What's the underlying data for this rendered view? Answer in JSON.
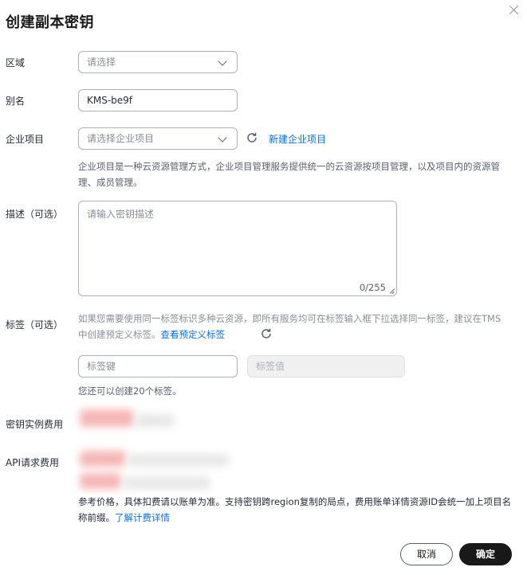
{
  "dialog": {
    "title": "创建副本密钥",
    "close_icon": "close-icon"
  },
  "region": {
    "label": "区域",
    "placeholder": "请选择",
    "icon": "chevron-down-icon"
  },
  "alias": {
    "label": "别名",
    "value": "KMS-be9f"
  },
  "enterprise_project": {
    "label": "企业项目",
    "placeholder": "请选择企业项目",
    "refresh_icon": "refresh-icon",
    "new_link": "新建企业项目",
    "help": "企业项目是一种云资源管理方式，企业项目管理服务提供统一的云资源按项目管理，以及项目内的资源管理、成员管理。"
  },
  "description": {
    "label": "描述（可选）",
    "placeholder": "请输入密钥描述",
    "counter": "0/255"
  },
  "tags": {
    "label": "标签（可选）",
    "help_prefix": "如果您需要使用同一标签标识多种云资源，即所有服务均可在标签输入框下拉选择同一标签，建议在TMS中创建预定义标签。",
    "view_link": "查看预定义标签",
    "refresh_icon": "refresh-icon",
    "key_placeholder": "标签键",
    "value_placeholder": "标签值",
    "remaining": "您还可以创建20个标签。"
  },
  "key_instance_fee": {
    "label": "密钥实例费用"
  },
  "api_fee": {
    "label": "API请求费用"
  },
  "pricing_note": {
    "text": "参考价格，具体扣费请以账单为准。支持密钥跨region复制的局点，费用账单详情资源ID会统一加上项目名称前缀。",
    "link": "了解计费详情"
  },
  "footer": {
    "cancel_label": "取消",
    "ok_label": "确定"
  },
  "colors": {
    "link": "#0d6edc",
    "primary_button": "#191919",
    "border": "#adb0b8"
  }
}
